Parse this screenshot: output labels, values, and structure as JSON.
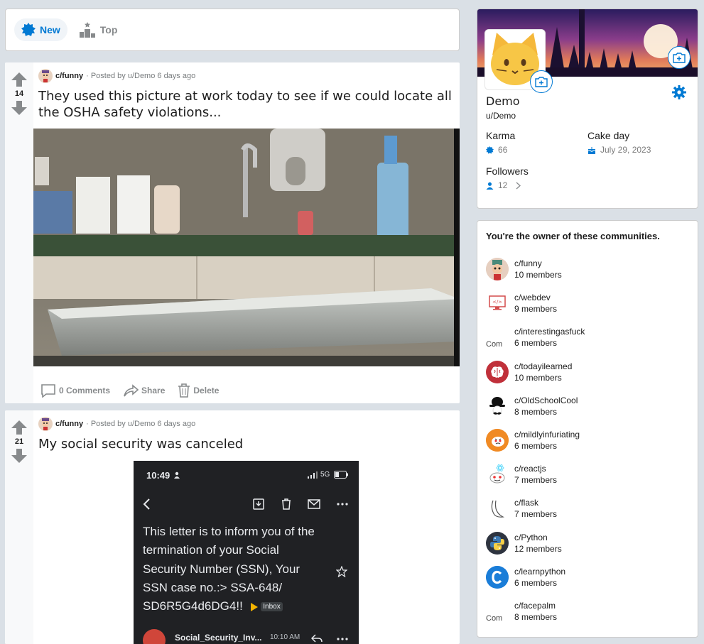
{
  "sort": {
    "new_label": "New",
    "top_label": "Top"
  },
  "posts": [
    {
      "votes": "14",
      "community": "c/funny",
      "posted_by": "· Posted by u/Demo 6 days ago",
      "title": "They used this picture at work today to see if we could locate all the OSHA safety violations...",
      "comments": "0 Comments",
      "share": "Share",
      "delete": "Delete"
    },
    {
      "votes": "21",
      "community": "c/funny",
      "posted_by": "· Posted by u/Demo 6 days ago",
      "title": "My social security was canceled",
      "phone": {
        "time": "10:49",
        "network": "5G",
        "letter": "This letter is to inform you of the termination of your Social Security Number (SSN), Your SSN case no.:> SSA-648/ SD6R5G4d6DG4!!",
        "inbox_badge": "Inbox",
        "sender": "Social_Security_Inv...",
        "sent_time": "10:10 AM"
      }
    }
  ],
  "profile": {
    "name": "Demo",
    "handle": "u/Demo",
    "karma_label": "Karma",
    "karma_value": "66",
    "cakeday_label": "Cake day",
    "cakeday_value": "July 29, 2023",
    "followers_label": "Followers",
    "followers_value": "12"
  },
  "communities": {
    "title": "You're the owner of these communities.",
    "items": [
      {
        "name": "c/funny",
        "members": "10 members",
        "icon": "funny-avatar"
      },
      {
        "name": "c/webdev",
        "members": "9 members",
        "icon": "code-monitor"
      },
      {
        "name": "c/interestingasfuck",
        "members": "6 members",
        "icon": "broken-image",
        "alt": "Com"
      },
      {
        "name": "c/todayilearned",
        "members": "10 members",
        "icon": "brain"
      },
      {
        "name": "c/OldSchoolCool",
        "members": "8 members",
        "icon": "bowler-hat"
      },
      {
        "name": "c/mildlyinfuriating",
        "members": "6 members",
        "icon": "angry-snoo"
      },
      {
        "name": "c/reactjs",
        "members": "7 members",
        "icon": "react-snoo"
      },
      {
        "name": "c/flask",
        "members": "7 members",
        "icon": "flask-horn"
      },
      {
        "name": "c/Python",
        "members": "12 members",
        "icon": "python-logo"
      },
      {
        "name": "c/learnpython",
        "members": "6 members",
        "icon": "c-logo"
      },
      {
        "name": "c/facepalm",
        "members": "8 members",
        "icon": "broken-image",
        "alt": "Com"
      }
    ]
  }
}
